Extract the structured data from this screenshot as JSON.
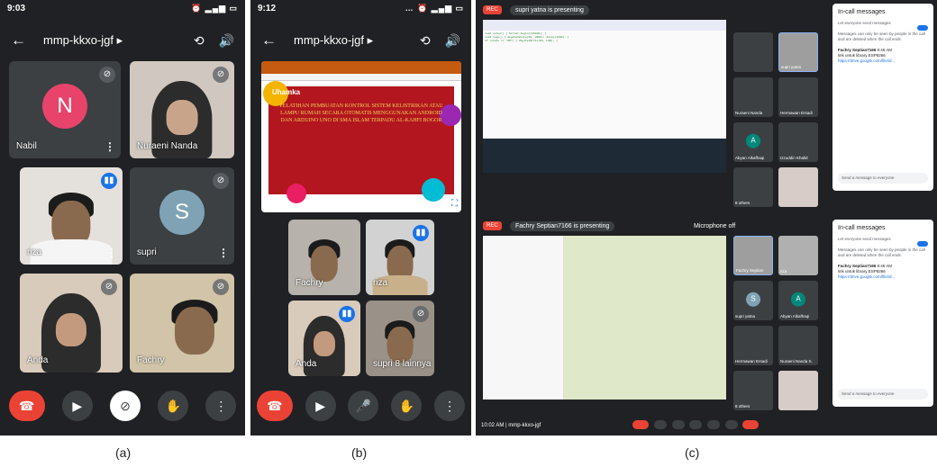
{
  "panel_a": {
    "time": "9:03",
    "meeting_code": "mmp-kkxo-jgf",
    "participants": [
      {
        "name": "Nabil",
        "initial": "N",
        "color": "#e8446b"
      },
      {
        "name": "Nuraeni Nanda",
        "initial": ""
      },
      {
        "name": "riza",
        "initial": ""
      },
      {
        "name": "supri",
        "initial": "S",
        "color": "#7fa3b5"
      },
      {
        "name": "Anda",
        "initial": ""
      },
      {
        "name": "Fachry",
        "initial": ""
      }
    ]
  },
  "panel_b": {
    "time": "9:12",
    "meeting_code": "mmp-kkxo-jgf",
    "slide_logo": "Uhamka",
    "slide_title": "PELATIHAN PEMBUATAN KONTROL SISTEM KELISTRIKAN ATAU LAMPU RUMAH SECARA OTOMATIS MENGGUNAKAN ANDROID DAN ARDUINO UNO DI SMA ISLAM TERPADU AL-KAHFI BOGOR",
    "participants": [
      {
        "name": "Fachry"
      },
      {
        "name": "riza"
      },
      {
        "name": "Anda"
      },
      {
        "name": "supri"
      }
    ],
    "others": "8 lainnya"
  },
  "panel_c": {
    "top": {
      "rec": "REC",
      "presenting": "supri yatna is presenting",
      "chat_title": "In-call messages",
      "chat_toggle": "Let everyone send messages",
      "chat_notice": "Messages can only be seen by people in the call and are deleted when the call ends.",
      "msg_sender": "Fachry Septian7166",
      "msg_time": "9:46 AM",
      "msg_text": "link untuk library ESP8266",
      "msg_link": "https://drive.google.com/file/d/...",
      "chat_input": "Send a message to everyone",
      "tiles": [
        {
          "name": ""
        },
        {
          "name": "supri yatna"
        },
        {
          "name": "Nuraeni Nanda"
        },
        {
          "name": "Hermawan Ersadi"
        },
        {
          "name": "Abyan Alkafhaqi",
          "initial": "A"
        },
        {
          "name": "Izzuddin Khalid"
        },
        {
          "name": "8 others"
        },
        {
          "name": ""
        }
      ]
    },
    "bottom": {
      "rec": "REC",
      "presenting": "Fachry Septian7166 is presenting",
      "mic_off": "Microphone off",
      "chat_title": "In-call messages",
      "chat_toggle": "Let everyone send messages",
      "chat_notice": "Messages can only be seen by people in the call and are deleted when the call ends.",
      "msg_sender": "Fachry Septian7166",
      "msg_time": "9:46 AM",
      "msg_text": "link untuk library ESP8266",
      "msg_link": "https://drive.google.com/file/d/...",
      "chat_input": "Send a message to everyone",
      "tiles": [
        {
          "name": "Fachry Septian"
        },
        {
          "name": "riza"
        },
        {
          "name": "supri yatna",
          "initial": "S"
        },
        {
          "name": "Abyan Alkafhaqi",
          "initial": "A"
        },
        {
          "name": "Hermawan Ersadi"
        },
        {
          "name": "Nuraeni Nanda S."
        },
        {
          "name": "8 others"
        },
        {
          "name": ""
        }
      ],
      "clock": "10:02 AM",
      "code": "mmp-kkxo-jgf"
    }
  },
  "captions": {
    "a": "(a)",
    "b": "(b)",
    "c": "(c)"
  }
}
